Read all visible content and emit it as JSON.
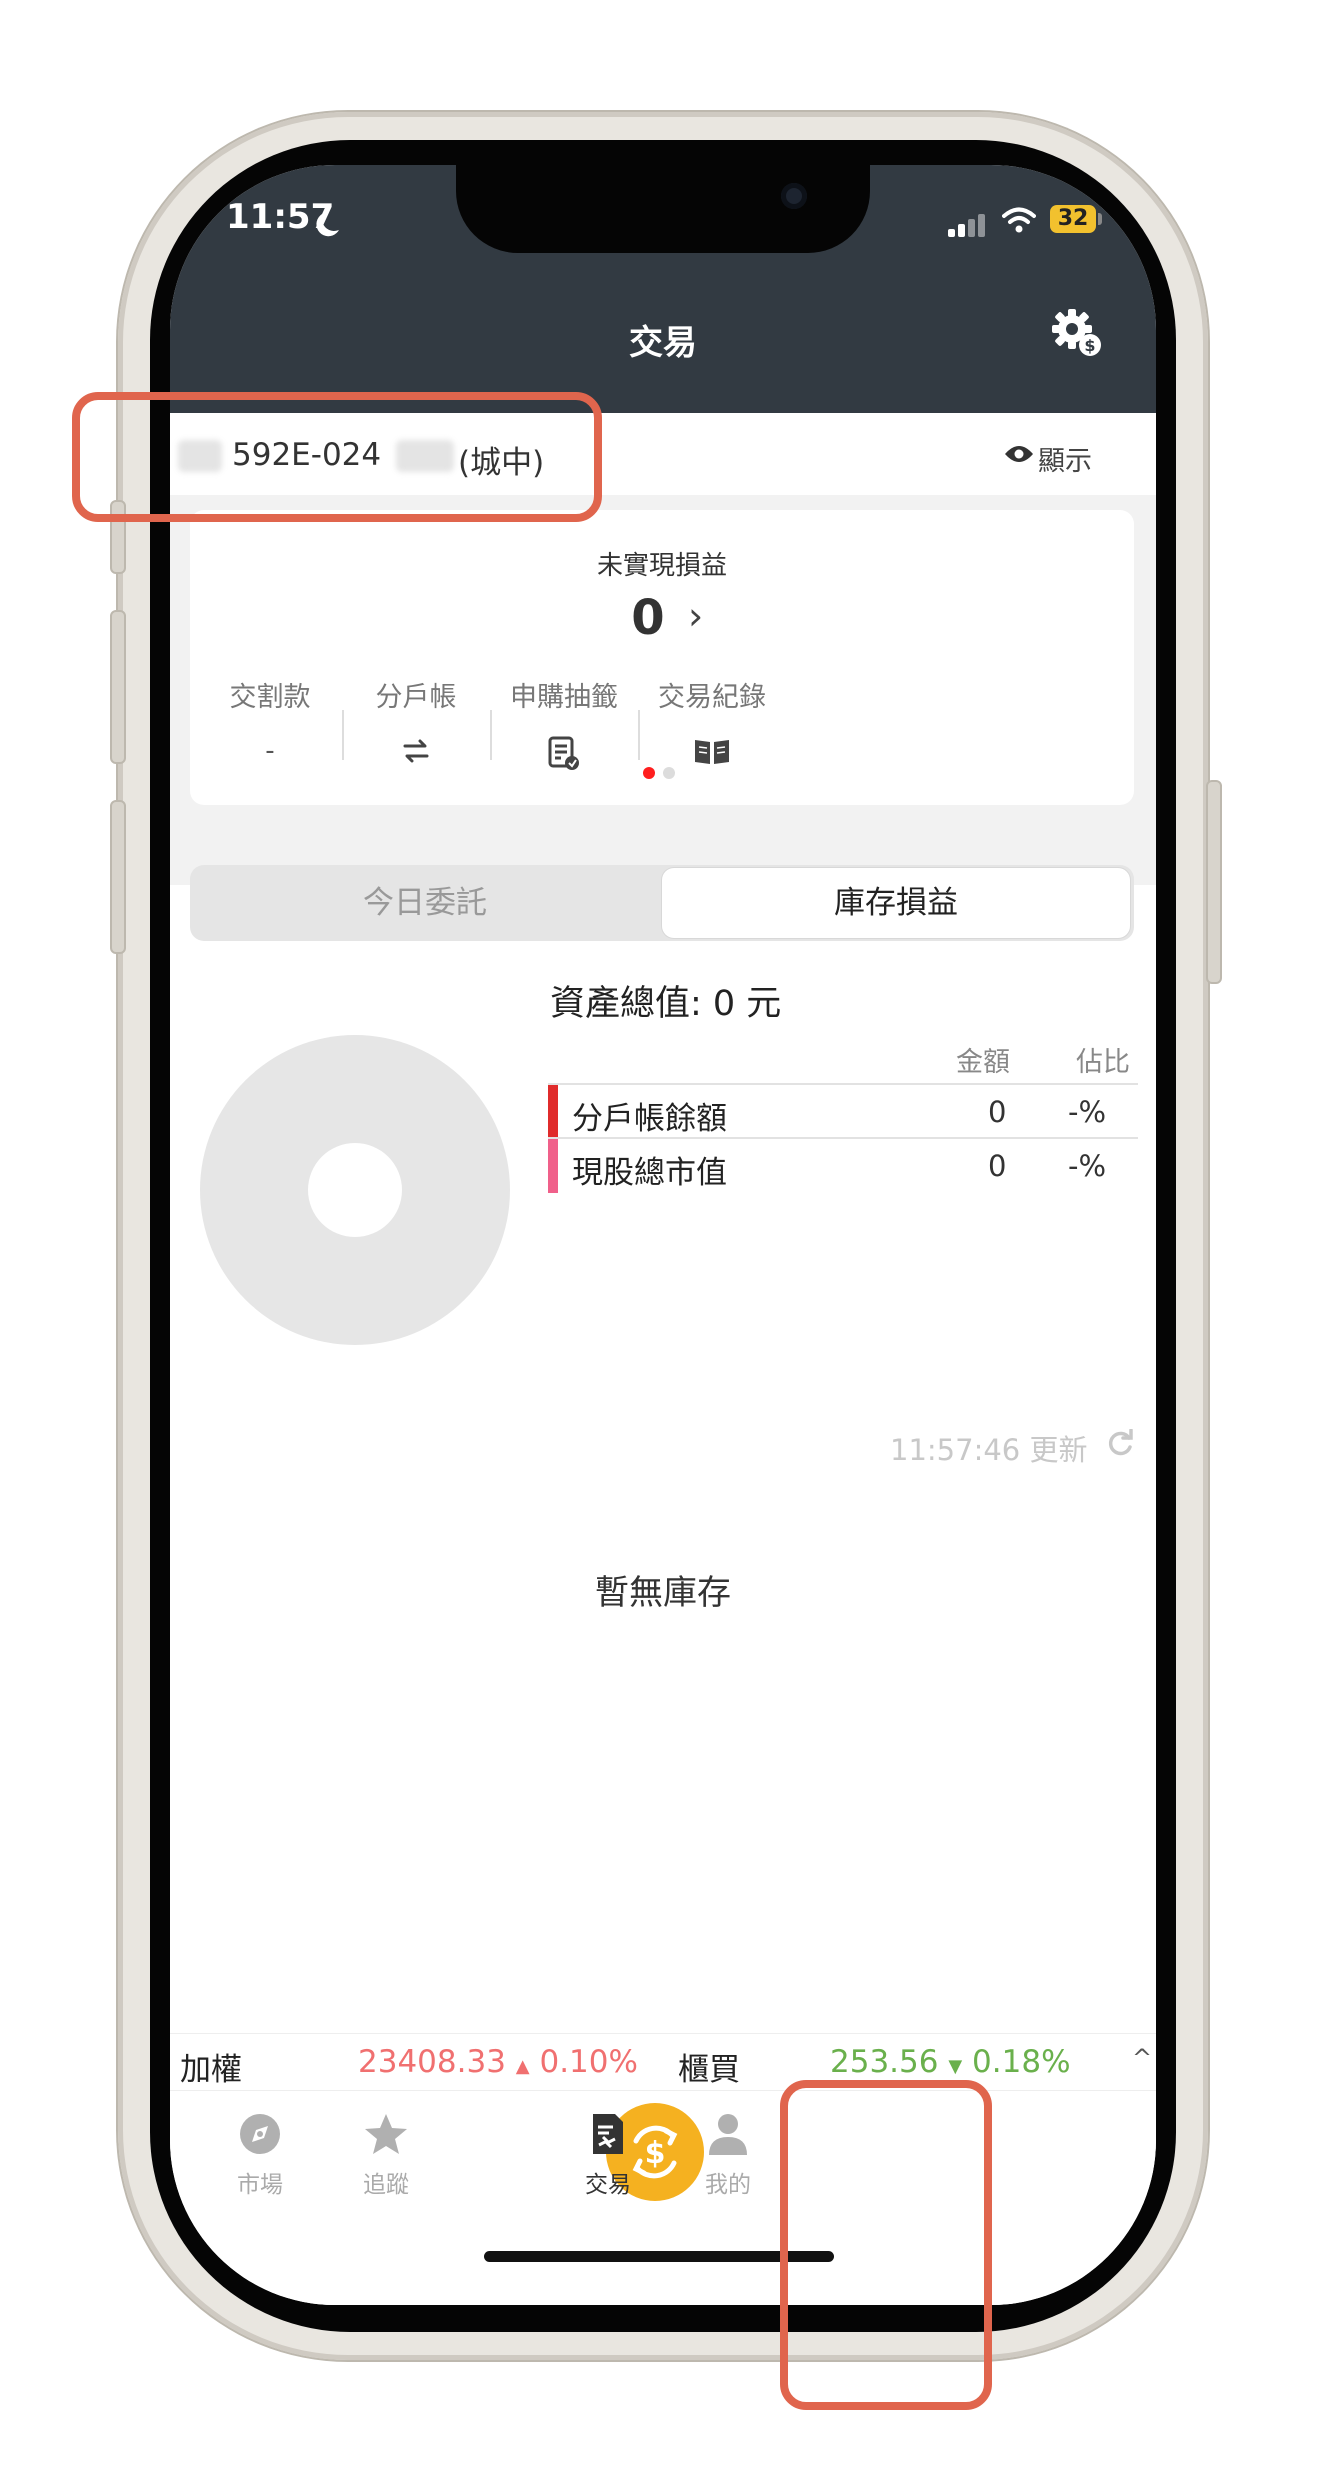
{
  "status_bar": {
    "time": "11:57",
    "battery": "32"
  },
  "header": {
    "title": "交易"
  },
  "account": {
    "number_visible": "592E-024",
    "branch": "(城中)",
    "show_label": "顯示"
  },
  "summary": {
    "label": "未實現損益",
    "value": "0",
    "quick_actions": [
      {
        "label": "交割款",
        "value": "-"
      },
      {
        "label": "分戶帳",
        "icon": "transfer-icon"
      },
      {
        "label": "申購抽籤",
        "icon": "lottery-doc-icon"
      },
      {
        "label": "交易紀錄",
        "icon": "book-icon"
      }
    ]
  },
  "tabs": {
    "left": "今日委託",
    "right": "庫存損益"
  },
  "assets": {
    "title": "資產總值: 0 元",
    "col_amount": "金額",
    "col_ratio": "佔比",
    "rows": [
      {
        "name": "分戶帳餘額",
        "amount": "0",
        "ratio": "-%",
        "color": "#e02b2b"
      },
      {
        "name": "現股總市值",
        "amount": "0",
        "ratio": "-%",
        "color": "#f0608a"
      }
    ]
  },
  "updated": {
    "time": "11:57:46",
    "label": "更新"
  },
  "empty_state": "暫無庫存",
  "indices": [
    {
      "name": "加權",
      "value": "23408.33",
      "arrow": "▲",
      "change": "0.10%",
      "color": "#f07070"
    },
    {
      "name": "櫃買",
      "value": "253.56",
      "arrow": "▼",
      "change": "0.18%",
      "color": "#6ab04c",
      "toggle": "^"
    }
  ],
  "nav": {
    "market": "市場",
    "watch": "追蹤",
    "trade": "交易",
    "me": "我的"
  },
  "colors": {
    "header_bg": "#323a42",
    "accent": "#f5b120",
    "highlight": "#e0654d"
  }
}
